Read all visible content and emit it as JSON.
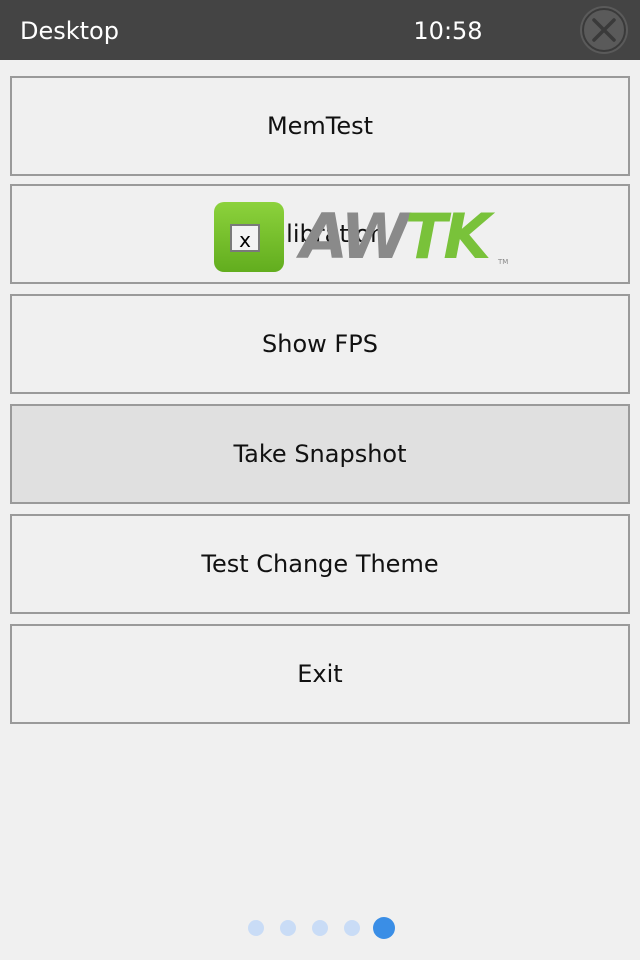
{
  "titlebar": {
    "title": "Desktop",
    "time": "10:58",
    "close_icon": "close-x-icon"
  },
  "menu": {
    "items": [
      {
        "label": "MemTest"
      },
      {
        "label": "Calibration"
      },
      {
        "label": "Show FPS"
      },
      {
        "label": "Take Snapshot"
      },
      {
        "label": "Test Change Theme"
      },
      {
        "label": "Exit"
      }
    ],
    "focused_index": 3
  },
  "logo": {
    "word_left": "AW",
    "word_right": "TK",
    "trademark": "TM",
    "icon_badge": "x"
  },
  "pager": {
    "count": 5,
    "active_index": 4
  },
  "colors": {
    "titlebar_bg": "#444444",
    "background": "#f0f0f0",
    "focused_bg": "#e0e0e0",
    "dot_active": "#3a8ee6",
    "dot_inactive": "#c9dcf6",
    "logo_green": "#79c23a",
    "logo_gray": "#8a8a8a"
  }
}
